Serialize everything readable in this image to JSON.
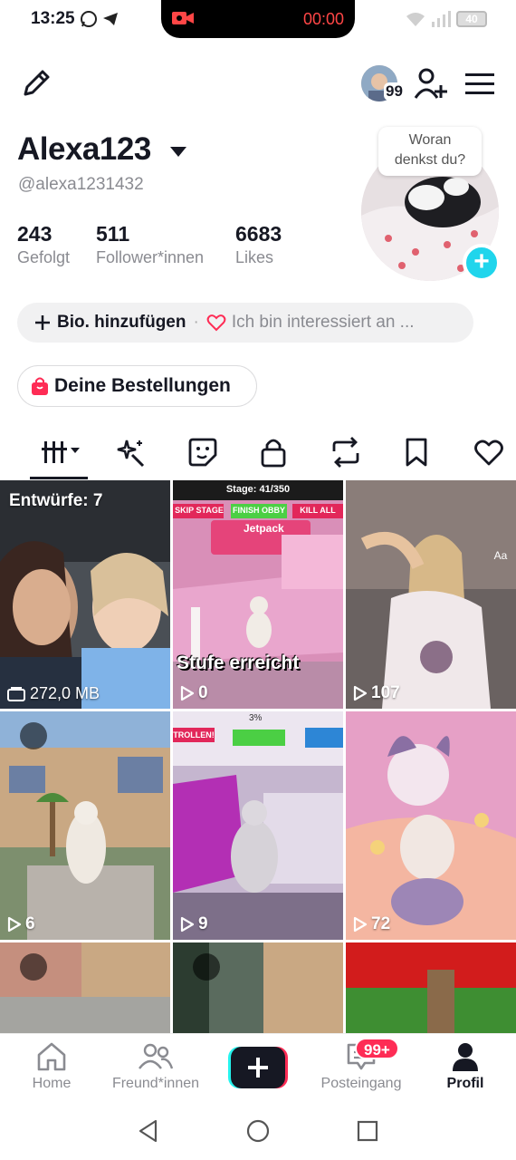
{
  "status_bar": {
    "time": "13:25",
    "recording_time": "00:00",
    "battery": "40"
  },
  "header": {
    "edit_icon": "pencil-icon",
    "notification_count": "99",
    "add_friend_icon": "person-plus-icon",
    "menu_icon": "hamburger-icon"
  },
  "profile": {
    "username": "Alexa123",
    "handle": "@alexa1231432",
    "stats": [
      {
        "value": "243",
        "label": "Gefolgt"
      },
      {
        "value": "511",
        "label": "Follower*innen"
      },
      {
        "value": "6683",
        "label": "Likes"
      }
    ],
    "bubble_text_1": "Woran",
    "bubble_text_2": "denkst du?",
    "add_photo": "+"
  },
  "bio": {
    "add_label": "Bio. hinzufügen",
    "interest_label": "Ich bin interessiert an ..."
  },
  "orders": {
    "label": "Deine Bestellungen"
  },
  "tabs": [
    {
      "name": "videos",
      "icon": "grid-icon"
    },
    {
      "name": "effects",
      "icon": "sparkle-icon"
    },
    {
      "name": "stickers",
      "icon": "sticker-icon"
    },
    {
      "name": "private",
      "icon": "lock-icon"
    },
    {
      "name": "reposts",
      "icon": "repost-icon"
    },
    {
      "name": "favorites",
      "icon": "bookmark-icon"
    },
    {
      "name": "liked",
      "icon": "heart-icon"
    }
  ],
  "grid": {
    "drafts_label": "Entwürfe: 7",
    "drafts_size": "272,0 MB",
    "tiles": [
      {
        "views": "0",
        "caption": "Stufe erreicht",
        "stage": "Stage: 41/350",
        "badges": [
          "SKIP STAGE",
          "FINISH OBBY",
          "KILL ALL"
        ],
        "item": "Jetpack"
      },
      {
        "views": "107"
      },
      {
        "views": "6"
      },
      {
        "views": "9",
        "banner": "TROLLEN!",
        "percent": "3%"
      },
      {
        "views": "72"
      }
    ],
    "text_tools": "Aa"
  },
  "bottom_nav": [
    {
      "label": "Home",
      "icon": "home-icon"
    },
    {
      "label": "Freund*innen",
      "icon": "friends-icon"
    },
    {
      "label": "",
      "icon": "create-icon"
    },
    {
      "label": "Posteingang",
      "icon": "inbox-icon",
      "badge": "99+"
    },
    {
      "label": "Profil",
      "icon": "profile-icon"
    }
  ],
  "colors": {
    "accent_cyan": "#20d5ec",
    "accent_red": "#fe2c55",
    "text_primary": "#161823",
    "text_secondary": "#8a8b91"
  }
}
